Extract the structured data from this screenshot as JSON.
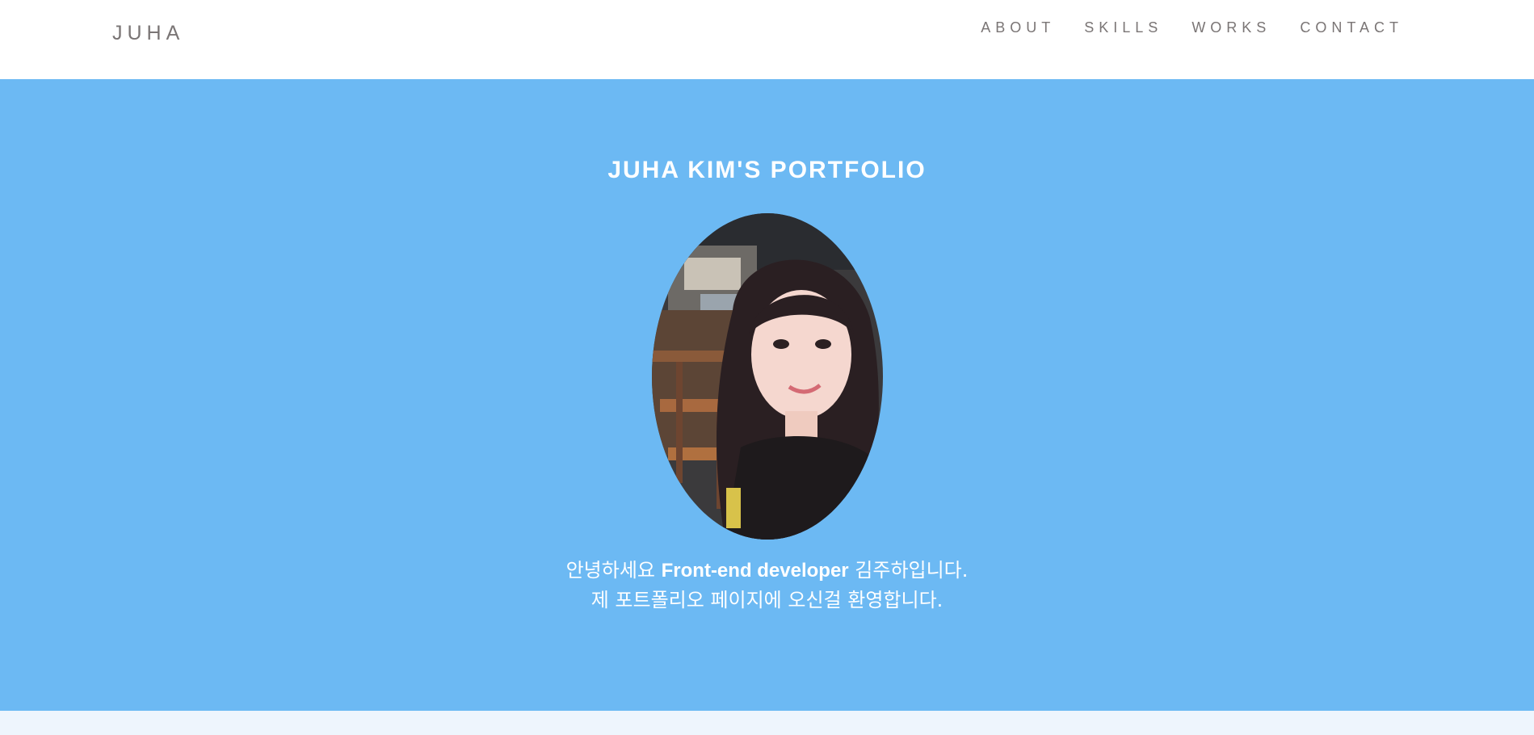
{
  "brand": "JUHA",
  "nav": {
    "items": [
      "ABOUT",
      "SKILLS",
      "WORKS",
      "CONTACT"
    ]
  },
  "hero": {
    "title": "JUHA KIM'S PORTFOLIO",
    "intro_line1_prefix": "안녕하세요 ",
    "intro_line1_bold": "Front-end developer",
    "intro_line1_suffix": " 김주하입니다.",
    "intro_line2": "제 포트폴리오 페이지에 오신걸 환영합니다."
  },
  "colors": {
    "hero_bg": "#6cb9f3",
    "nav_text": "#7a7575",
    "next_section_bg": "#eef5fd"
  },
  "icons": {
    "portrait": "profile-photo"
  }
}
